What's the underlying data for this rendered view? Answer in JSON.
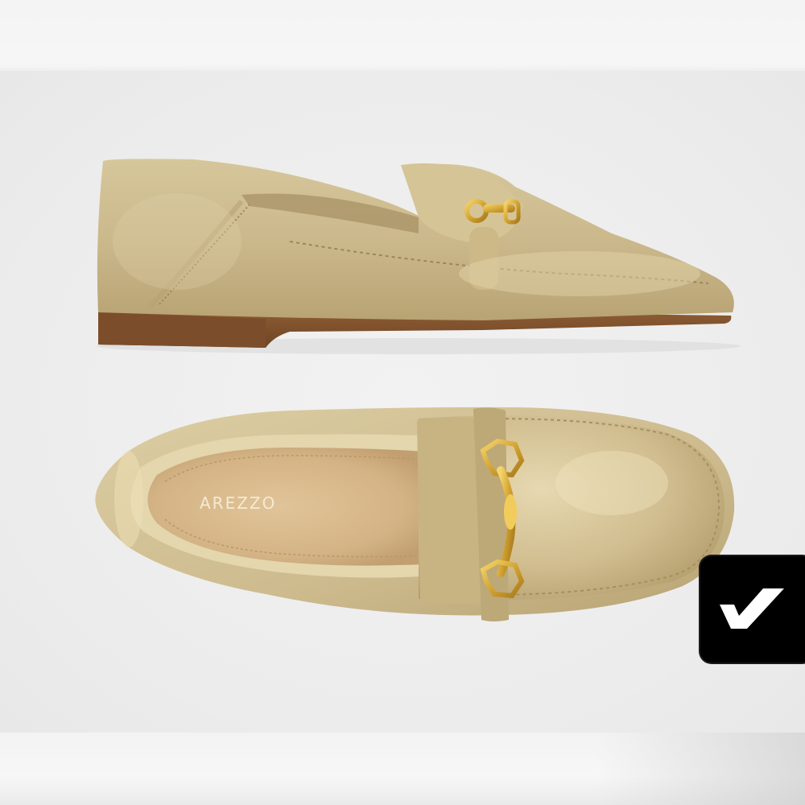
{
  "product": {
    "brand_on_insole": "AREZZO",
    "colors": {
      "leather": "#cdbb8e",
      "leather_highlight": "#e3d4a9",
      "leather_shadow": "#a99468",
      "hardware": "#d9ac3a",
      "sole": "#8a5a32",
      "insole": "#d8b98c"
    }
  },
  "badge": {
    "icon": "check-swoosh-icon",
    "background": "#000000",
    "foreground": "#ffffff"
  }
}
